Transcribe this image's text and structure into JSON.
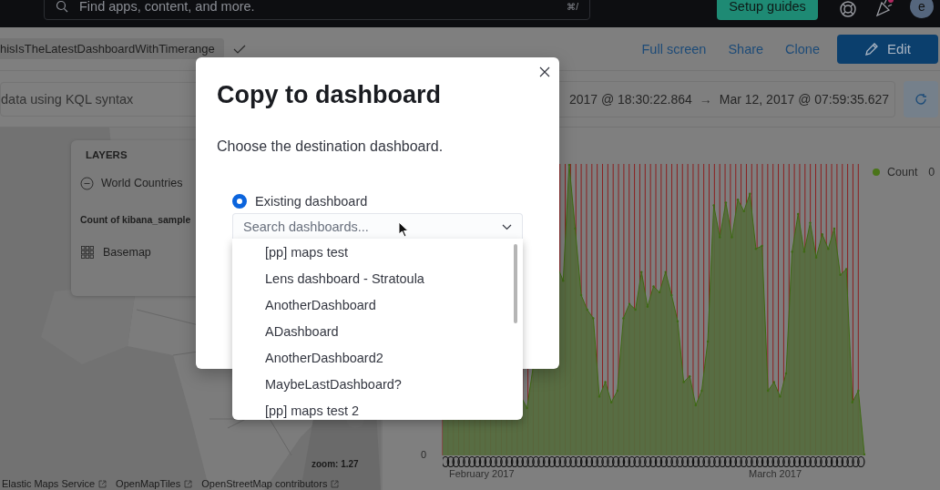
{
  "top_bar": {
    "search": {
      "placeholder": "Find apps, content, and more.",
      "shortcut": "⌘/"
    },
    "setup_button": "Setup guides",
    "avatar": "e"
  },
  "header": {
    "breadcrumb": "hisIsTheLatestDashboardWithTimerange",
    "actions": [
      "Full screen",
      "Share",
      "Clone"
    ],
    "edit_button": "Edit"
  },
  "query": {
    "placeholder": "data using KQL syntax",
    "start": "2017 @ 18:30:22.864",
    "arrow": "→",
    "end": "Mar 12, 2017 @ 07:59:35.627"
  },
  "map": {
    "layers_title": "LAYERS",
    "layers": [
      {
        "kind": "vector",
        "name": "World Countries"
      },
      {
        "kind": "heading",
        "name": "Count of kibana_sample"
      },
      {
        "kind": "basemap",
        "name": "Basemap"
      }
    ],
    "zoom": "zoom: 1.27",
    "attribution": [
      "Elastic Maps Service",
      "OpenMapTiles",
      "OpenStreetMap contributors"
    ]
  },
  "chart": {
    "legend": {
      "name": "Count",
      "value": "0",
      "color": "#4a7419"
    },
    "y_label": "0",
    "x_labels": [
      "February 2017",
      "March 2017"
    ]
  },
  "modal": {
    "title": "Copy to dashboard",
    "description": "Choose the destination dashboard.",
    "options": [
      {
        "label": "Existing dashboard",
        "selected": true
      }
    ],
    "combo": {
      "placeholder": "Search dashboards..."
    },
    "results": [
      "[pp] maps test",
      "Lens dashboard - Stratoula",
      "AnotherDashboard",
      "ADashboard",
      "AnotherDashboard2",
      "MaybeLastDashboard?",
      "[pp] maps test 2"
    ]
  }
}
